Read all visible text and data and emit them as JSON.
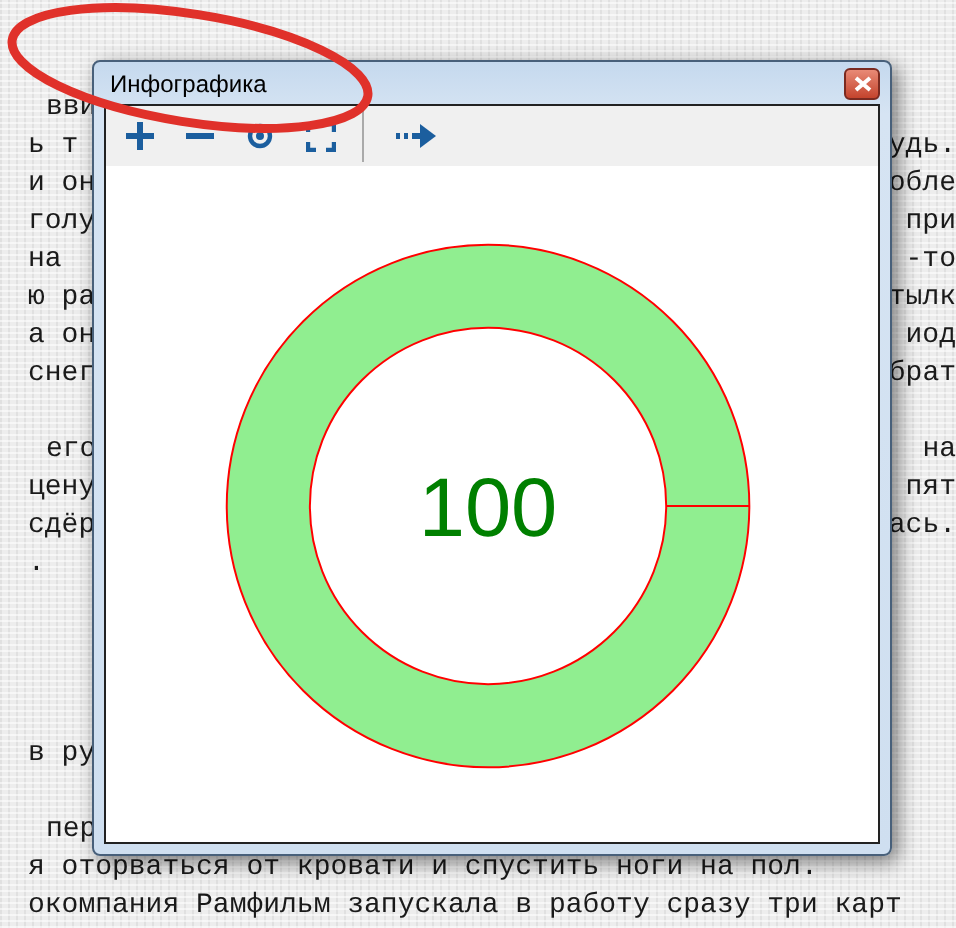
{
  "document": {
    "lines": [
      {
        "kind": "line",
        "left": "вви",
        "indent": true
      },
      {
        "kind": "line",
        "left": "ь т",
        "right": "удь.",
        "indent": false
      },
      {
        "kind": "line",
        "left": "и он",
        "right": "обле",
        "indent": false
      },
      {
        "kind": "line",
        "left": "голу",
        "right": "при",
        "indent": false
      },
      {
        "kind": "line",
        "left": "на",
        "right": "-то",
        "indent": false
      },
      {
        "kind": "line",
        "left": "ю ра",
        "right": "тылк",
        "indent": false
      },
      {
        "kind": "line",
        "left": "а он",
        "right": "иод",
        "indent": false
      },
      {
        "kind": "line",
        "left": "снег",
        "right": "брат",
        "indent": false
      },
      {
        "kind": "paragraph",
        "left": "его",
        "right": "на",
        "indent": true
      },
      {
        "kind": "line",
        "left": "цену",
        "right": "пят",
        "indent": false
      },
      {
        "kind": "line",
        "left": "сдёр",
        "right": "ась.",
        "indent": false
      },
      {
        "kind": "line",
        "left": ".",
        "indent": false
      },
      {
        "kind": "section",
        "left": "в ру",
        "indent": false
      },
      {
        "kind": "paragraph",
        "left": "пер",
        "indent": true
      },
      {
        "kind": "line",
        "left": "я оторваться от кровати и спустить ноги на пол.",
        "indent": false
      },
      {
        "kind": "line",
        "left": "окомпания Рамфильм запускала в работу сразу три карт",
        "indent": false
      }
    ]
  },
  "window": {
    "title": "Инфографика"
  },
  "gauge": {
    "level": 1,
    "reading": "100"
  }
}
